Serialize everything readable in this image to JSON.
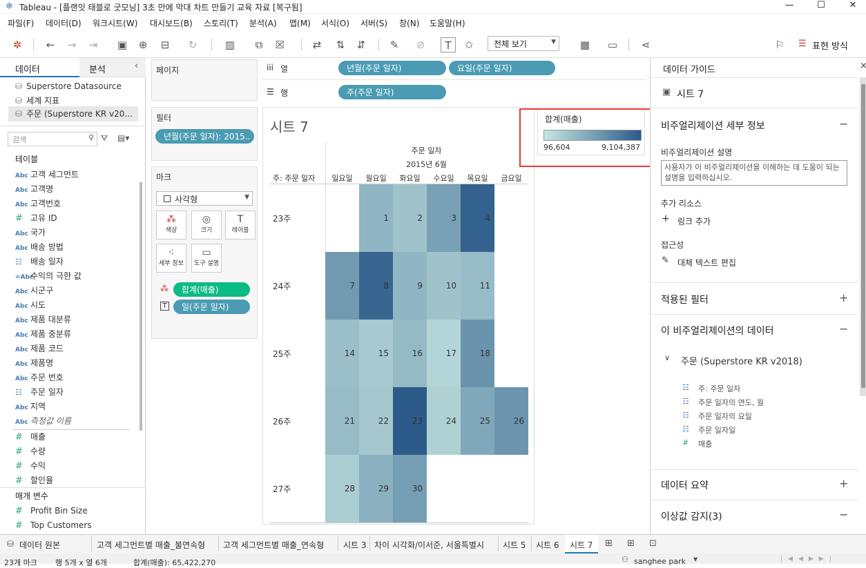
{
  "window": {
    "title": "Tableau - [플랜잇 태블로 굿모닝] 3초 만에 막대 차트 만들기 교육 자료 [복구됨]",
    "controls": [
      "—",
      "☐",
      "✕"
    ]
  },
  "menu": [
    "파일(F)",
    "데이터(D)",
    "워크시트(W)",
    "대시보드(B)",
    "스토리(T)",
    "분석(A)",
    "맵(M)",
    "서식(O)",
    "서버(S)",
    "창(N)",
    "도움말(H)"
  ],
  "toolbar": {
    "fit_select": "전체 보기",
    "present_label": "표현 방식"
  },
  "left_pane": {
    "tabs": [
      "데이터",
      "분석"
    ],
    "datasources": [
      "Superstore Datasource",
      "세계 지표",
      "주문 (Superstore KR v20..."
    ],
    "search_placeholder": "검색",
    "tables_header": "테이블",
    "dimensions": [
      {
        "type": "Abc",
        "name": "고객 세그먼트"
      },
      {
        "type": "Abc",
        "name": "고객명"
      },
      {
        "type": "Abc",
        "name": "고객번호"
      },
      {
        "type": "#",
        "name": "고유 ID"
      },
      {
        "type": "Abc",
        "name": "국가"
      },
      {
        "type": "Abc",
        "name": "배송 방법"
      },
      {
        "type": "date",
        "name": "배송 일자"
      },
      {
        "type": "=Abc",
        "name": "수익의 극한 값"
      },
      {
        "type": "Abc",
        "name": "시군구"
      },
      {
        "type": "Abc",
        "name": "시도"
      },
      {
        "type": "Abc",
        "name": "제품 대분류"
      },
      {
        "type": "Abc",
        "name": "제품 중분류"
      },
      {
        "type": "Abc",
        "name": "제품 코드"
      },
      {
        "type": "Abc",
        "name": "제품명"
      },
      {
        "type": "Abc",
        "name": "주문 번호"
      },
      {
        "type": "date",
        "name": "주문 일자"
      },
      {
        "type": "Abc",
        "name": "지역"
      },
      {
        "type": "Abc",
        "name": "측정값 이름"
      }
    ],
    "measures": [
      {
        "type": "#",
        "name": "매출"
      },
      {
        "type": "#",
        "name": "수량"
      },
      {
        "type": "#",
        "name": "수익"
      },
      {
        "type": "#",
        "name": "할인율"
      }
    ],
    "params_header": "매개 변수",
    "params": [
      "Profit Bin Size",
      "Top Customers"
    ]
  },
  "shelves": {
    "pages_label": "페이지",
    "filters_label": "필터",
    "filter_pill": "년월(주문 일자): 2015..",
    "marks_label": "마크",
    "mark_type": "사각형",
    "mark_buttons": [
      "색상",
      "크기",
      "레이블",
      "세부 정보",
      "도구 설명"
    ],
    "mark_pills": [
      "합계(매출)",
      "일(주문 일자)"
    ],
    "columns_label": "열",
    "rows_label": "행",
    "column_pills": [
      "년월(주문 일자)",
      "요일(주문 일자)"
    ],
    "row_pills": [
      "주(주문 일자)"
    ]
  },
  "viz": {
    "sheet_title": "시트 7",
    "header_top": "주문 일자",
    "header_month": "2015년 6월",
    "row_header_title": "주: 주문 일자"
  },
  "legend": {
    "title": "합계(매출)",
    "min": "96,604",
    "max": "9,104,387",
    "color_low": "#c6e6e1",
    "color_high": "#2c5b8a"
  },
  "chart_data": {
    "type": "heatmap",
    "title": "시트 7",
    "columns": [
      "일요일",
      "월요일",
      "화요일",
      "수요일",
      "목요일",
      "금요일"
    ],
    "rows": [
      "23주",
      "24주",
      "25주",
      "26주",
      "27주"
    ],
    "cells": [
      {
        "row": "23주",
        "col": "월요일",
        "label": "1",
        "intensity": 0.35
      },
      {
        "row": "23주",
        "col": "화요일",
        "label": "2",
        "intensity": 0.25
      },
      {
        "row": "23주",
        "col": "수요일",
        "label": "3",
        "intensity": 0.5
      },
      {
        "row": "23주",
        "col": "목요일",
        "label": "4",
        "intensity": 0.95
      },
      {
        "row": "24주",
        "col": "일요일",
        "label": "7",
        "intensity": 0.55
      },
      {
        "row": "24주",
        "col": "월요일",
        "label": "8",
        "intensity": 0.92
      },
      {
        "row": "24주",
        "col": "화요일",
        "label": "9",
        "intensity": 0.35
      },
      {
        "row": "24주",
        "col": "수요일",
        "label": "10",
        "intensity": 0.25
      },
      {
        "row": "24주",
        "col": "목요일",
        "label": "11",
        "intensity": 0.3
      },
      {
        "row": "25주",
        "col": "일요일",
        "label": "14",
        "intensity": 0.28
      },
      {
        "row": "25주",
        "col": "월요일",
        "label": "15",
        "intensity": 0.2
      },
      {
        "row": "25주",
        "col": "화요일",
        "label": "16",
        "intensity": 0.32
      },
      {
        "row": "25주",
        "col": "수요일",
        "label": "17",
        "intensity": 0.12
      },
      {
        "row": "25주",
        "col": "목요일",
        "label": "18",
        "intensity": 0.6
      },
      {
        "row": "26주",
        "col": "일요일",
        "label": "21",
        "intensity": 0.3
      },
      {
        "row": "26주",
        "col": "월요일",
        "label": "22",
        "intensity": 0.22
      },
      {
        "row": "26주",
        "col": "화요일",
        "label": "23",
        "intensity": 1.0
      },
      {
        "row": "26주",
        "col": "수요일",
        "label": "24",
        "intensity": 0.15
      },
      {
        "row": "26주",
        "col": "목요일",
        "label": "25",
        "intensity": 0.45
      },
      {
        "row": "26주",
        "col": "금요일",
        "label": "26",
        "intensity": 0.58
      },
      {
        "row": "27주",
        "col": "일요일",
        "label": "28",
        "intensity": 0.18
      },
      {
        "row": "27주",
        "col": "월요일",
        "label": "29",
        "intensity": 0.38
      },
      {
        "row": "27주",
        "col": "화요일",
        "label": "30",
        "intensity": 0.52
      }
    ]
  },
  "right_pane": {
    "header": "데이터 가이드",
    "sheet_name": "시트 7",
    "viz_detail": "비주얼리제이션 세부 정보",
    "viz_desc_label": "비주얼리제이션 설명",
    "viz_desc_placeholder": "사용자가 이 비주얼리제이션을 이해하는 데 도움이 되는 설명을 입력하십시오.",
    "extra_resources": "추가 리소스",
    "add_link": "링크 추가",
    "accessibility": "접근성",
    "alt_text": "대체 텍스트 편집",
    "applied_filters": "적용된 필터",
    "viz_data": "이 비주얼리제이션의 데이터",
    "datasource": "주문 (Superstore KR v2018)",
    "fields": [
      "주: 주문 일자",
      "주문 일자의 연도, 월",
      "주문 일자의 요일",
      "주문 일자일",
      "매출"
    ],
    "data_summary": "데이터 요약",
    "outliers": "이상값 감지(3)"
  },
  "bottom_tabs": [
    "데이터 원본",
    "고객 세그먼트별 매출_불연속형",
    "고객 세그먼트별 매출_연속형",
    "시트 3",
    "차이 시각화/이서준, 서울특별시",
    "시트 5",
    "시트 6",
    "시트 7"
  ],
  "status": {
    "marks": "23개 마크",
    "rows_cols": "행 5개 x 열 6개",
    "sum": "합계(매출): 65,422,270",
    "user": "sanghee park"
  }
}
